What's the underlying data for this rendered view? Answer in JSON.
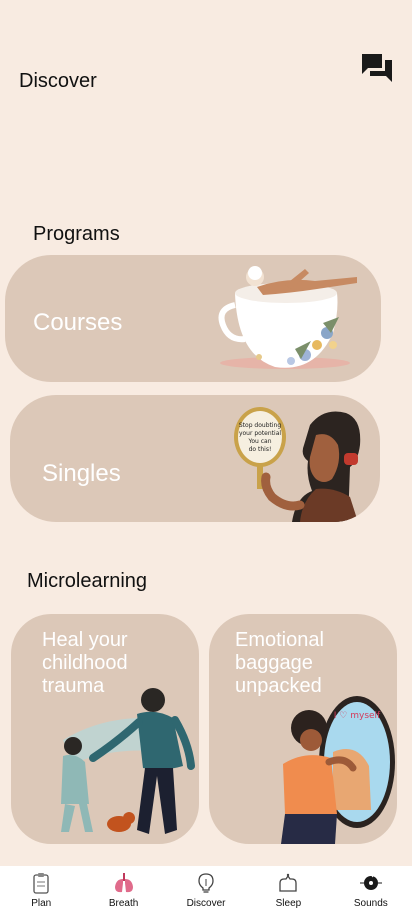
{
  "header": {
    "title": "Discover",
    "chat_icon": "chat-bubbles-icon"
  },
  "programs": {
    "title": "Programs",
    "cards": [
      {
        "label": "Courses",
        "illustration": "woman-in-teacup"
      },
      {
        "label": "Singles",
        "illustration": "woman-with-mirror"
      }
    ],
    "mirror_text": "Stop doubting your potential You can do this!"
  },
  "microlearning": {
    "title": "Microlearning",
    "cards": [
      {
        "label": "Heal your childhood trauma",
        "illustration": "woman-walking-with-child"
      },
      {
        "label": "Emotional baggage unpacked",
        "illustration": "hug-in-mirror"
      }
    ],
    "mirror_text": "I ♡ myself"
  },
  "nav": [
    {
      "label": "Plan",
      "icon": "clipboard-icon"
    },
    {
      "label": "Breath",
      "icon": "lungs-icon"
    },
    {
      "label": "Discover",
      "icon": "lightbulb-icon"
    },
    {
      "label": "Sleep",
      "icon": "sleep-icon"
    },
    {
      "label": "Sounds",
      "icon": "music-disc-icon"
    }
  ],
  "colors": {
    "background": "#f8ebe1",
    "card": "#dcc8b8",
    "nav_accent": "#e06b8b"
  }
}
